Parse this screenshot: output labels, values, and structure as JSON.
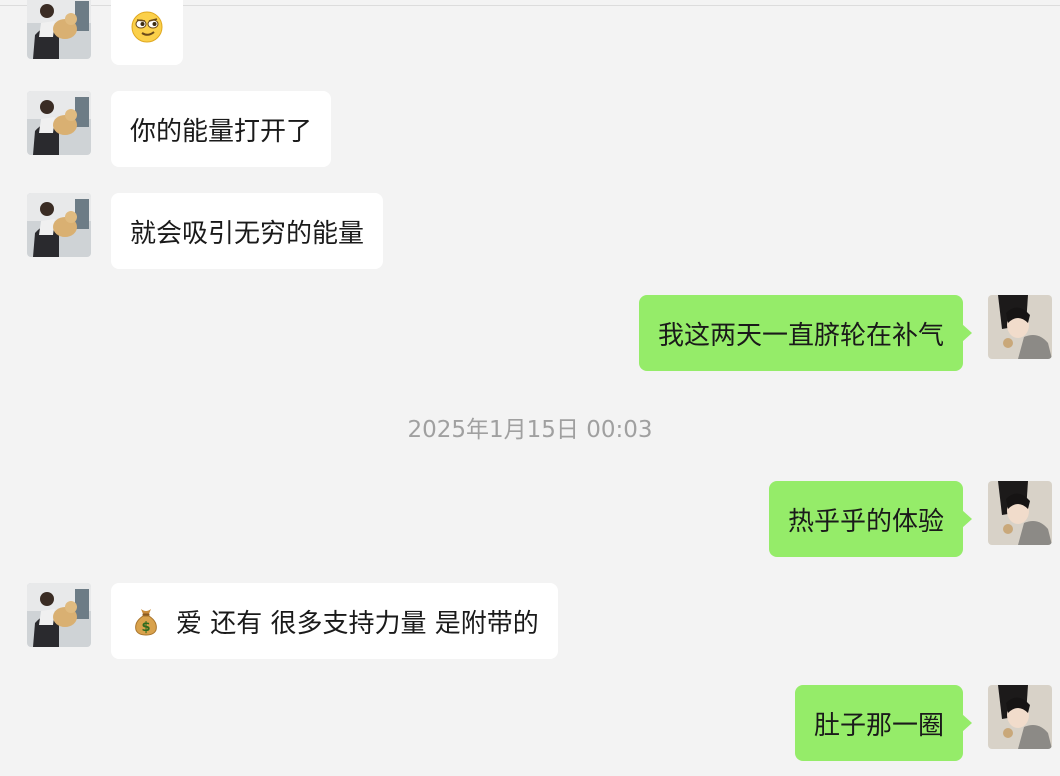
{
  "timestamp": "2025年1月15日 00:03",
  "messages": [
    {
      "side": "left",
      "text": "",
      "emoji": "smirk-face-icon"
    },
    {
      "side": "left",
      "text": "你的能量打开了"
    },
    {
      "side": "left",
      "text": "就会吸引无穷的能量"
    },
    {
      "side": "right",
      "text": "我这两天一直脐轮在补气"
    },
    {
      "side": "right",
      "text": "热乎乎的体验"
    },
    {
      "side": "left",
      "text": "爱 还有 很多支持力量 是附带的",
      "emoji": "money-bag-icon"
    },
    {
      "side": "right",
      "text": "肚子那一圈"
    }
  ],
  "colors": {
    "background": "#f3f3f3",
    "incoming_bubble": "#ffffff",
    "outgoing_bubble": "#95ec69",
    "timestamp_text": "#a0a0a0"
  }
}
